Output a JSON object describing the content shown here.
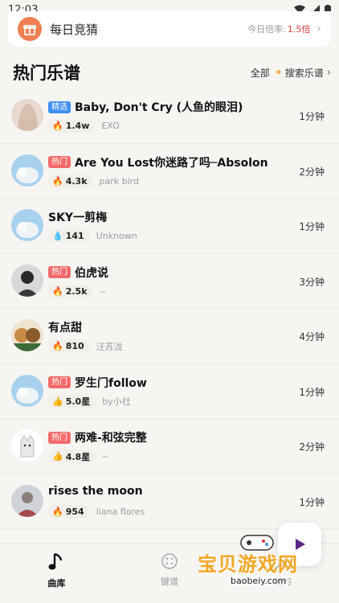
{
  "status": {
    "time": "12:03"
  },
  "daily": {
    "label": "每日竞猜",
    "rate_label": "今日倍率:",
    "rate_value": "1.5倍"
  },
  "section": {
    "title": "热门乐谱",
    "all": "全部",
    "search": "搜索乐谱"
  },
  "songs": [
    {
      "tag": "精选",
      "tag_type": "select",
      "title": "Baby, Don't Cry (人鱼的眼泪)",
      "metric_icon": "fire-icon",
      "metric": "1.4w",
      "artist": "EXO",
      "duration": "1分钟"
    },
    {
      "tag": "热门",
      "tag_type": "hot",
      "title": "Are You Lost你迷路了吗─Absolon",
      "metric_icon": "fire-icon",
      "metric": "4.3k",
      "artist": "park bird",
      "duration": "2分钟"
    },
    {
      "tag": "",
      "tag_type": "",
      "title": "SKY一剪梅",
      "metric_icon": "blue-fire-icon",
      "metric": "141",
      "artist": "Unknown",
      "duration": "1分钟"
    },
    {
      "tag": "热门",
      "tag_type": "hot",
      "title": "伯虎说",
      "metric_icon": "fire-icon",
      "metric": "2.5k",
      "artist": "--",
      "duration": "3分钟"
    },
    {
      "tag": "",
      "tag_type": "",
      "title": "有点甜",
      "metric_icon": "fire-icon",
      "metric": "810",
      "artist": "汪苏泷",
      "duration": "4分钟"
    },
    {
      "tag": "热门",
      "tag_type": "hot",
      "title": "罗生门follow",
      "metric_icon": "thumb-icon",
      "metric": "5.0星",
      "artist": "by小社",
      "duration": "1分钟"
    },
    {
      "tag": "热门",
      "tag_type": "hot",
      "title": "两难-和弦完整",
      "metric_icon": "thumb-icon",
      "metric": "4.8星",
      "artist": "--",
      "duration": "2分钟"
    },
    {
      "tag": "",
      "tag_type": "",
      "title": "rises the moon",
      "metric_icon": "fire-icon",
      "metric": "954",
      "artist": "liana flores",
      "duration": "1分钟"
    }
  ],
  "tabs": [
    {
      "label": "曲库",
      "icon": "music-note-icon",
      "active": true
    },
    {
      "label": "键谱",
      "icon": "keypad-icon",
      "active": false
    },
    {
      "label": "我的",
      "icon": "profile-icon",
      "active": false
    }
  ],
  "watermark": {
    "title": "宝贝游戏网",
    "url": "baobeiy.com"
  },
  "colors": {
    "accent": "#f07f52",
    "hot_tag": "#f26b6b",
    "select_tag": "#3f8ff0",
    "rate": "#e23b3b"
  }
}
